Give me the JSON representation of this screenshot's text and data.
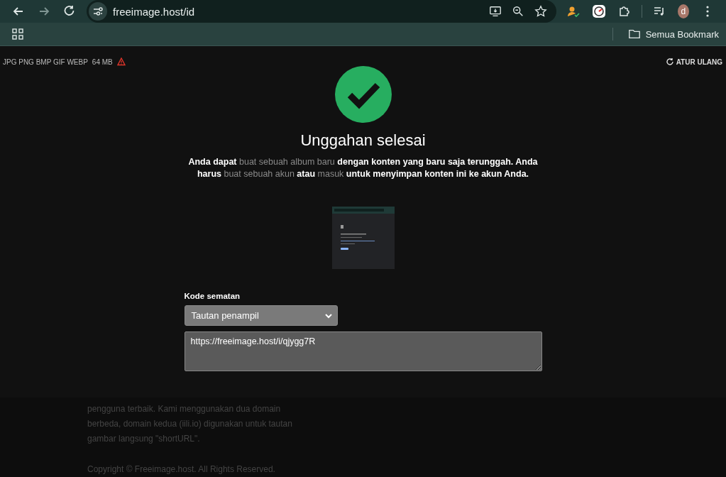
{
  "browser": {
    "url": "freeimage.host/id",
    "bookmarks_label": "Semua Bookmark",
    "profile_initial": "d"
  },
  "upload_bar": {
    "formats": "JPG PNG BMP GIF WEBP",
    "max_size": "64 MB",
    "reset": "ATUR ULANG"
  },
  "result": {
    "title": "Unggahan selesai",
    "message": [
      {
        "kind": "text",
        "text": "Anda dapat"
      },
      {
        "kind": "link",
        "text": "buat sebuah album baru"
      },
      {
        "kind": "text",
        "text": "dengan konten yang baru saja terunggah. Anda harus"
      },
      {
        "kind": "link",
        "text": "buat sebuah akun"
      },
      {
        "kind": "text",
        "text": "atau"
      },
      {
        "kind": "link",
        "text": "masuk"
      },
      {
        "kind": "text",
        "text": "untuk menyimpan konten ini ke akun Anda."
      }
    ],
    "embed_label": "Kode sematan",
    "embed_select": "Tautan penampil",
    "embed_code": "https://freeimage.host/i/qjygg7R"
  },
  "footer": {
    "lines": [
      "pengguna terbaik. Kami menggunakan dua domain",
      "berbeda, domain kedua (iili.io) digunakan untuk tautan",
      "gambar langsung \"shortURL\"."
    ],
    "copyright": "Copyright © Freeimage.host. All Rights Reserved."
  }
}
